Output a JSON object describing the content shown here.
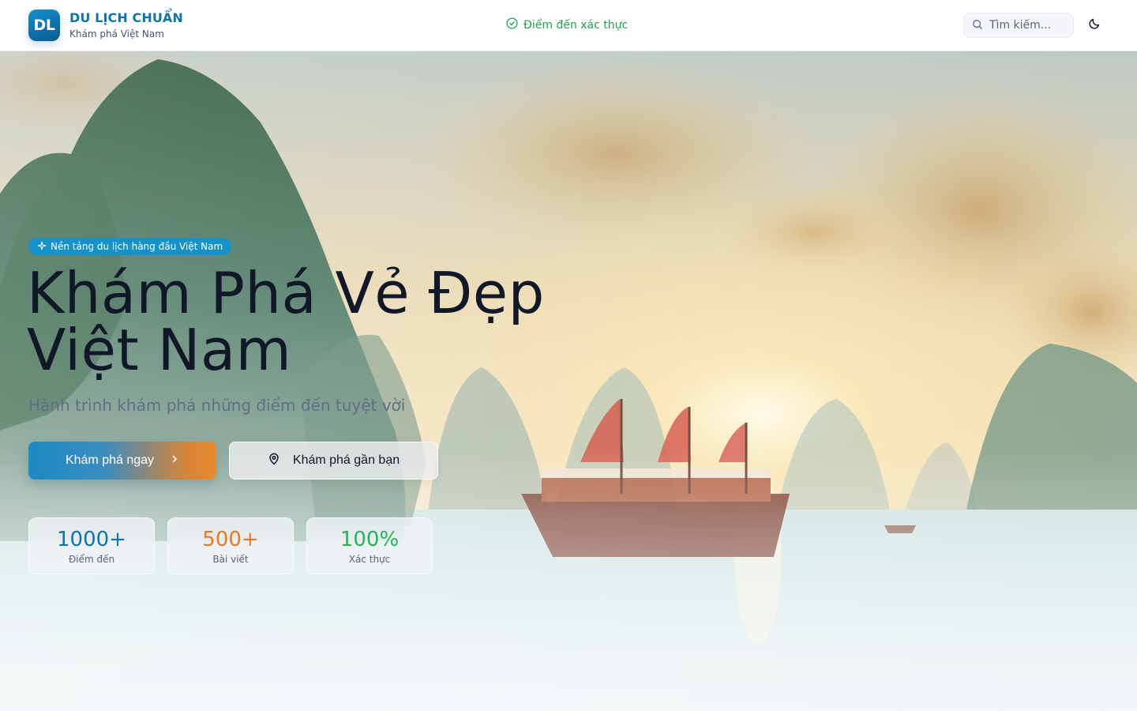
{
  "header": {
    "logo_text": "DL",
    "brand_title": "DU LỊCH CHUẨN",
    "brand_subtitle": "Khám phá Việt Nam",
    "verified_label": "Điểm đến xác thực",
    "search_placeholder": "Tìm kiếm...",
    "theme_icon": "moon-icon"
  },
  "hero": {
    "badge_label": "Nền tảng du lịch hàng đầu Việt Nam",
    "title_line1": "Khám Phá Vẻ Đẹp",
    "title_line2": "Việt Nam",
    "subtitle": "Hành trình khám phá những điểm đến tuyệt vời",
    "primary_button": "Khám phá ngay",
    "secondary_button": "Khám phá gần bạn",
    "stats": [
      {
        "value": "1000+",
        "label": "Điểm đến",
        "color": "#0e75ad"
      },
      {
        "value": "500+",
        "label": "Bài viết",
        "color": "#ea7a22"
      },
      {
        "value": "100%",
        "label": "Xác thực",
        "color": "#22b45a"
      }
    ]
  },
  "colors": {
    "brand": "#0e75ad",
    "accent_orange": "#ea7a22",
    "verified_green": "#22a35a",
    "badge_blue": "#1592c9"
  }
}
